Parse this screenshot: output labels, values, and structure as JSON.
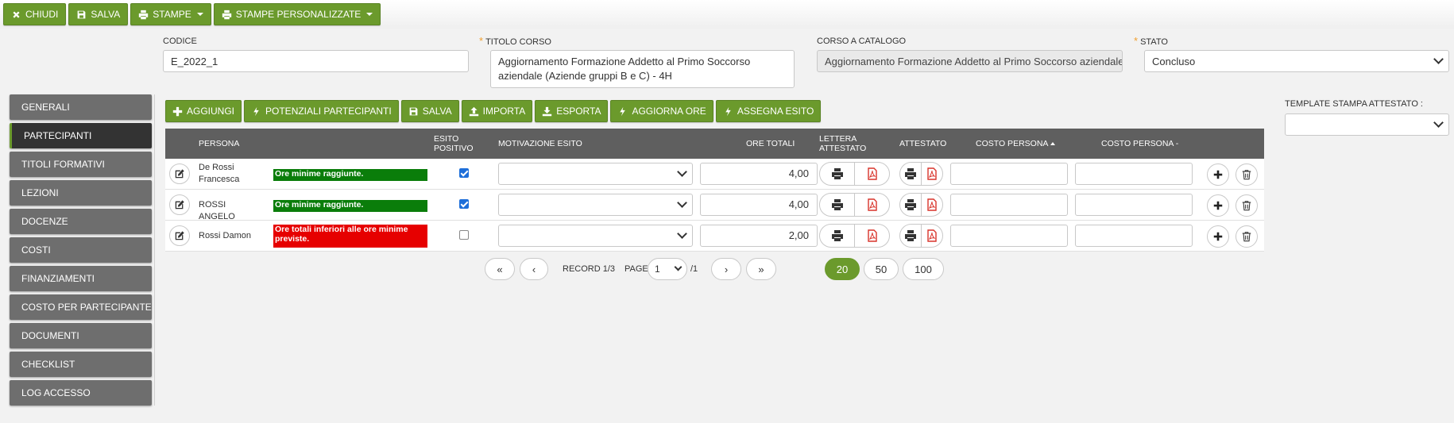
{
  "toolbar": {
    "close_label": "CHIUDI",
    "save_label": "SALVA",
    "print_label": "STAMPE",
    "custom_print_label": "STAMPE PERSONALIZZATE"
  },
  "form": {
    "codice_label": "CODICE",
    "codice_value": "E_2022_1",
    "titolo_label": "TITOLO CORSO",
    "titolo_value": "Aggiornamento Formazione Addetto al Primo Soccorso aziendale (Aziende gruppi B e C) - 4H",
    "catalogo_label": "CORSO A CATALOGO",
    "catalogo_value": "Aggiornamento Formazione Addetto al Primo Soccorso aziendale (",
    "stato_label": "STATO",
    "stato_value": "Concluso",
    "required_mark": "*"
  },
  "sidebar": {
    "items": [
      {
        "label": "GENERALI"
      },
      {
        "label": "PARTECIPANTI"
      },
      {
        "label": "TITOLI FORMATIVI"
      },
      {
        "label": "LEZIONI"
      },
      {
        "label": "DOCENZE"
      },
      {
        "label": "COSTI"
      },
      {
        "label": "FINANZIAMENTI"
      },
      {
        "label": "COSTO PER PARTECIPANTE"
      },
      {
        "label": "DOCUMENTI"
      },
      {
        "label": "CHECKLIST"
      },
      {
        "label": "LOG ACCESSO"
      }
    ],
    "active_index": 1
  },
  "actions": {
    "add": "AGGIUNGI",
    "potential": "POTENZIALI PARTECIPANTI",
    "save": "SALVA",
    "import": "IMPORTA",
    "export": "ESPORTA",
    "update_hours": "AGGIORNA ORE",
    "assign": "ASSEGNA ESITO"
  },
  "template": {
    "label": "TEMPLATE STAMPA ATTESTATO :"
  },
  "table": {
    "headers": {
      "persona": "PERSONA",
      "esito": "ESITO POSITIVO",
      "motivazione": "MOTIVAZIONE ESITO",
      "ore": "ORE TOTALI",
      "lettera": "LETTERA ATTESTATO",
      "attestato": "ATTESTATO",
      "costo1": "COSTO PERSONA",
      "costo2": "COSTO PERSONA -"
    },
    "rows": [
      {
        "name": "De Rossi Francesca",
        "status": "Ore minime raggiunte.",
        "status_type": "ok",
        "esito": true,
        "ore": "4,00"
      },
      {
        "name": "ROSSI ANGELO",
        "status": "Ore minime raggiunte.",
        "status_type": "ok",
        "esito": true,
        "ore": "4,00"
      },
      {
        "name": "Rossi Damon",
        "status": "Ore totali inferiori alle ore minime previste.",
        "status_type": "ko",
        "esito": false,
        "ore": "2,00"
      }
    ]
  },
  "pager": {
    "first": "«",
    "prev": "‹",
    "next": "›",
    "last": "»",
    "record_text": "RECORD 1/3",
    "page_label": "PAGE",
    "page_value": "1",
    "page_total": "/1",
    "sizes": [
      "20",
      "50",
      "100"
    ],
    "active_size": "20"
  },
  "colors": {
    "green": "#6b9a2c",
    "ok": "#0a7d0a",
    "ko": "#e60000",
    "pdf": "#d9342b"
  }
}
